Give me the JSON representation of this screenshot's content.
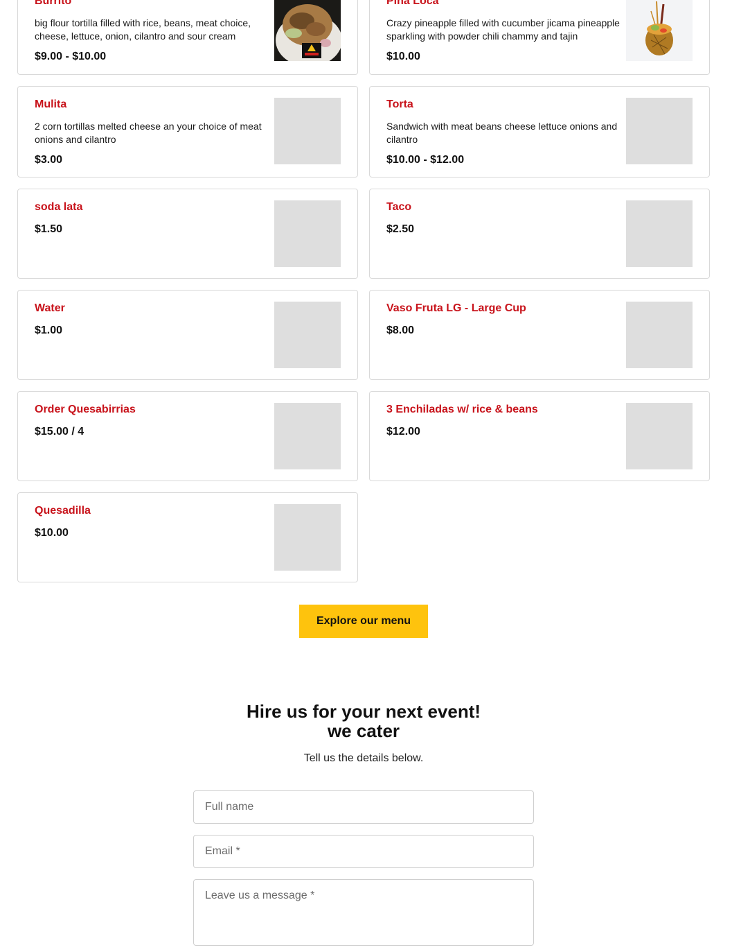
{
  "menu": {
    "items": [
      {
        "name": "Burrito",
        "description": "big flour tortilla filled with rice, beans, meat choice, cheese, lettuce, onion, cilantro and sour cream",
        "price": "$9.00 - $10.00",
        "image": "burrito-photo"
      },
      {
        "name": "Piña Loca",
        "description": "Crazy pineapple filled with cucumber jicama pineapple sparkling with powder chili chammy and tajin",
        "price": "$10.00",
        "image": "pineapple-photo"
      },
      {
        "name": "Mulita",
        "description": "2 corn tortillas melted cheese an your choice of meat onions and cilantro",
        "price": "$3.00",
        "image": "placeholder"
      },
      {
        "name": "Torta",
        "description": "Sandwich with meat beans cheese lettuce onions and cilantro",
        "price": "$10.00 - $12.00",
        "image": "placeholder"
      },
      {
        "name": "soda lata",
        "description": "",
        "price": "$1.50",
        "image": "placeholder"
      },
      {
        "name": "Taco",
        "description": "",
        "price": "$2.50",
        "image": "placeholder"
      },
      {
        "name": "Water",
        "description": "",
        "price": "$1.00",
        "image": "placeholder"
      },
      {
        "name": "Vaso Fruta LG - Large Cup",
        "description": "",
        "price": "$8.00",
        "image": "placeholder"
      },
      {
        "name": "Order Quesabirrias",
        "description": "",
        "price": "$15.00 / 4",
        "image": "placeholder"
      },
      {
        "name": "3 Enchiladas w/ rice & beans",
        "description": "",
        "price": "$12.00",
        "image": "placeholder"
      },
      {
        "name": "Quesadilla",
        "description": "",
        "price": "$10.00",
        "image": "placeholder"
      }
    ],
    "explore_label": "Explore our menu"
  },
  "catering": {
    "title_line1": "Hire us for your next event!",
    "title_line2": "we cater",
    "subtitle": "Tell us the details below."
  },
  "form": {
    "name_placeholder": "Full name",
    "email_placeholder": "Email *",
    "message_placeholder": "Leave us a message *"
  },
  "colors": {
    "item_name": "#c8131b",
    "cta_bg": "#fec30d",
    "placeholder_thumb": "#dedede"
  }
}
